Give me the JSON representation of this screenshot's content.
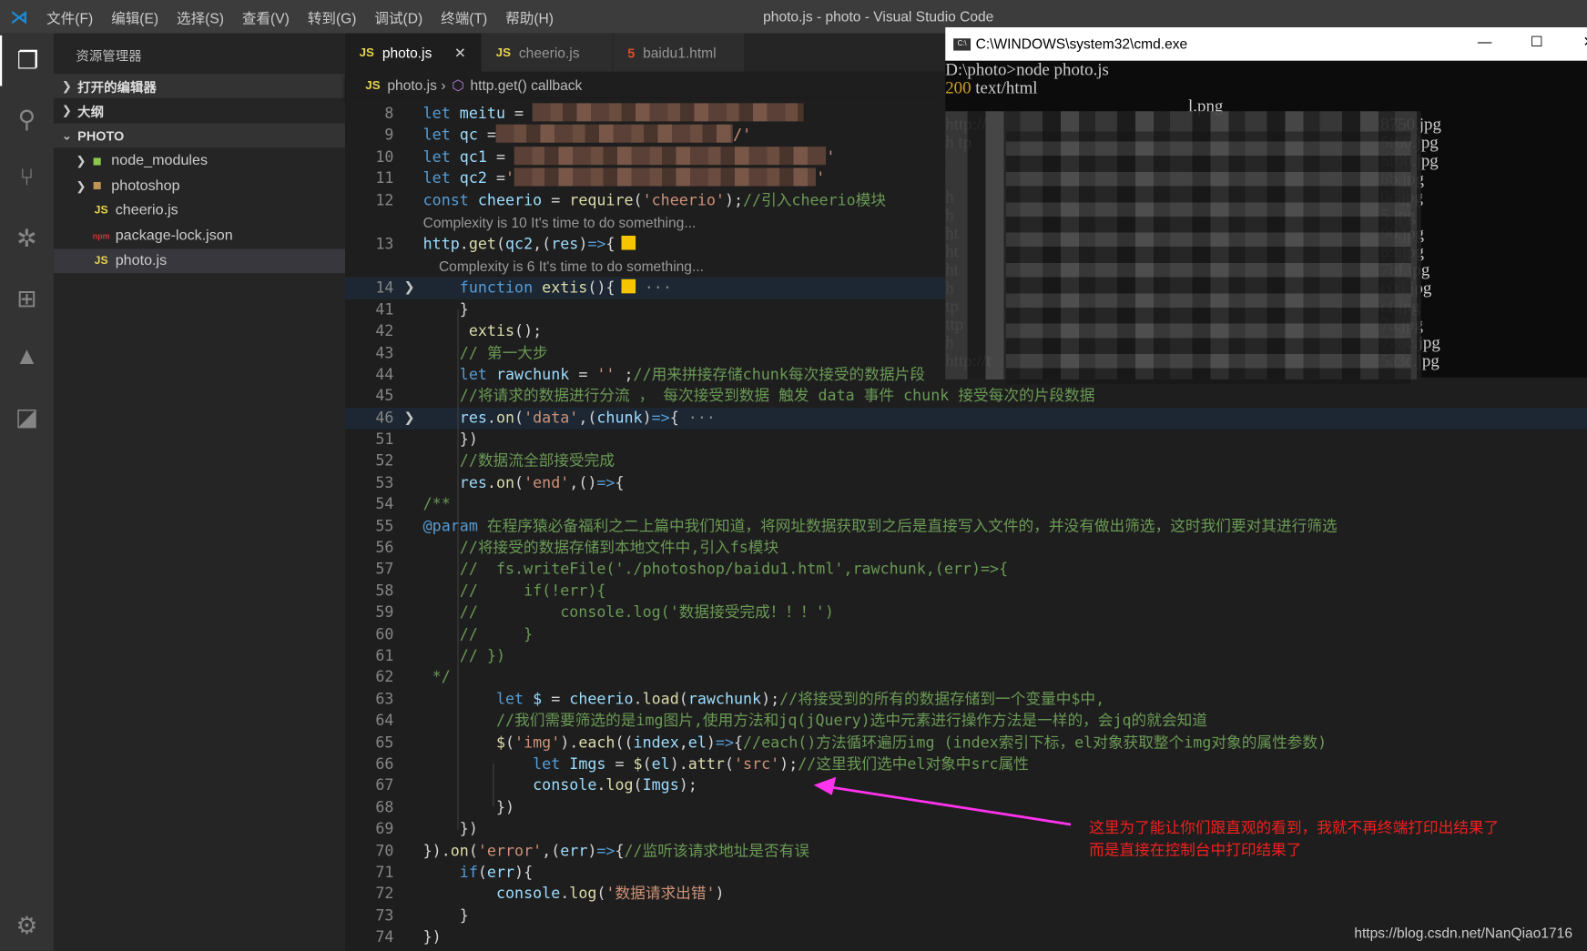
{
  "titlebar": {
    "menu": [
      "文件(F)",
      "编辑(E)",
      "选择(S)",
      "查看(V)",
      "转到(G)",
      "调试(D)",
      "终端(T)",
      "帮助(H)"
    ],
    "title": "photo.js - photo - Visual Studio Code"
  },
  "activity": [
    "files-icon",
    "search-icon",
    "source-control-icon",
    "debug-icon",
    "extensions-icon",
    "azure-icon",
    "remote-icon"
  ],
  "sidebar": {
    "header": "资源管理器",
    "sections": {
      "open_editors": "打开的编辑器",
      "outline": "大纲",
      "folder": "PHOTO"
    },
    "files": [
      {
        "name": "node_modules",
        "type": "folder",
        "icon": "node-folder-icon"
      },
      {
        "name": "photoshop",
        "type": "folder",
        "icon": "folder-icon"
      },
      {
        "name": "cheerio.js",
        "type": "js",
        "icon": "JS"
      },
      {
        "name": "package-lock.json",
        "type": "npm",
        "icon": "npm"
      },
      {
        "name": "photo.js",
        "type": "js",
        "icon": "JS",
        "selected": true
      }
    ]
  },
  "tabs": [
    {
      "label": "photo.js",
      "icon": "JS",
      "active": true,
      "close": "✕"
    },
    {
      "label": "cheerio.js",
      "icon": "JS"
    },
    {
      "label": "baidu1.html",
      "icon": "5"
    }
  ],
  "breadcrumb": {
    "file": "photo.js",
    "symbol": "http.get() callback",
    "icon": "JS"
  },
  "code": [
    {
      "n": "8",
      "t": [
        [
          "kw",
          "let"
        ],
        [
          "var",
          " meitu"
        ],
        [
          "op",
          " = "
        ],
        [
          "blur",
          ""
        ]
      ]
    },
    {
      "n": "9",
      "t": [
        [
          "kw",
          "let"
        ],
        [
          "var",
          " qc"
        ],
        [
          "op",
          " ="
        ],
        [
          "blur",
          ""
        ],
        [
          "str",
          "/'"
        ]
      ]
    },
    {
      "n": "10",
      "t": [
        [
          "kw",
          "let"
        ],
        [
          "var",
          " qc1"
        ],
        [
          "op",
          " = "
        ],
        [
          "blur",
          ""
        ],
        [
          "str",
          "'"
        ]
      ]
    },
    {
      "n": "11",
      "t": [
        [
          "kw",
          "let"
        ],
        [
          "var",
          " qc2"
        ],
        [
          "op",
          " ="
        ],
        [
          "str",
          "'"
        ],
        [
          "blur",
          ""
        ],
        [
          "str",
          "'"
        ]
      ]
    },
    {
      "n": "12",
      "t": [
        [
          "kw",
          "const"
        ],
        [
          "var",
          " cheerio"
        ],
        [
          "op",
          " = "
        ],
        [
          "fn",
          "require"
        ],
        [
          "pl",
          "("
        ],
        [
          "str",
          "'cheerio'"
        ],
        [
          "pl",
          ");"
        ],
        [
          "cm",
          "//引入cheerio模块"
        ]
      ]
    },
    {
      "lens": "Complexity is 10 It's time to do something..."
    },
    {
      "n": "13",
      "t": [
        [
          "var",
          "http"
        ],
        [
          "pl",
          "."
        ],
        [
          "fn",
          "get"
        ],
        [
          "pl",
          "("
        ],
        [
          "var",
          "qc2"
        ],
        [
          "pl",
          ",("
        ],
        [
          "var",
          "res"
        ],
        [
          "pl",
          ")"
        ],
        [
          "kw",
          "=>"
        ],
        [
          "pl",
          "{"
        ],
        [
          "sq",
          ""
        ]
      ]
    },
    {
      "lens": "    Complexity is 6 It's time to do something..."
    },
    {
      "n": "14",
      "fold": true,
      "hl": true,
      "t": [
        [
          "pl",
          "    "
        ],
        [
          "kw",
          "function"
        ],
        [
          "fn",
          " extis"
        ],
        [
          "pl",
          "(){"
        ],
        [
          "sq",
          ""
        ],
        [
          "dots",
          " ···"
        ]
      ]
    },
    {
      "n": "41",
      "t": [
        [
          "pl",
          "    }"
        ]
      ]
    },
    {
      "n": "42",
      "t": [
        [
          "pl",
          "     "
        ],
        [
          "fn",
          "extis"
        ],
        [
          "pl",
          "();"
        ]
      ]
    },
    {
      "n": "43",
      "t": [
        [
          "cm",
          "    // 第一大步"
        ]
      ]
    },
    {
      "n": "44",
      "t": [
        [
          "pl",
          "    "
        ],
        [
          "kw",
          "let"
        ],
        [
          "var",
          " rawchunk"
        ],
        [
          "op",
          " = "
        ],
        [
          "str",
          "''"
        ],
        [
          "pl",
          " ;"
        ],
        [
          "cm",
          "//用来拼接存储chunk每次接受的数据片段"
        ]
      ]
    },
    {
      "n": "45",
      "t": [
        [
          "cm",
          "    //将请求的数据进行分流 ， 每次接受到数据 触发 data 事件 chunk 接受每次的片段数据"
        ]
      ]
    },
    {
      "n": "46",
      "fold": true,
      "hl": true,
      "t": [
        [
          "pl",
          "    "
        ],
        [
          "var",
          "res"
        ],
        [
          "pl",
          "."
        ],
        [
          "fn",
          "on"
        ],
        [
          "pl",
          "("
        ],
        [
          "str",
          "'data'"
        ],
        [
          "pl",
          ",("
        ],
        [
          "var",
          "chunk"
        ],
        [
          "pl",
          ")"
        ],
        [
          "kw",
          "=>"
        ],
        [
          "pl",
          "{"
        ],
        [
          "dots",
          " ···"
        ]
      ]
    },
    {
      "n": "51",
      "t": [
        [
          "pl",
          "    })"
        ]
      ]
    },
    {
      "n": "52",
      "t": [
        [
          "cm",
          "    //数据流全部接受完成"
        ]
      ]
    },
    {
      "n": "53",
      "t": [
        [
          "pl",
          "    "
        ],
        [
          "var",
          "res"
        ],
        [
          "pl",
          "."
        ],
        [
          "fn",
          "on"
        ],
        [
          "pl",
          "("
        ],
        [
          "str",
          "'end'"
        ],
        [
          "pl",
          ",()"
        ],
        [
          "kw",
          "=>"
        ],
        [
          "pl",
          "{"
        ]
      ]
    },
    {
      "n": "54",
      "t": [
        [
          "cm",
          "/**"
        ]
      ]
    },
    {
      "n": "55",
      "t": [
        [
          "kw",
          "@param"
        ],
        [
          "cm",
          " 在程序猿必备福利之二上篇中我们知道，将网址数据获取到之后是直接写入文件的，并没有做出筛选，这时我们要对其进行筛选"
        ]
      ]
    },
    {
      "n": "56",
      "t": [
        [
          "cm",
          "    //将接受的数据存储到本地文件中,引入fs模块"
        ]
      ]
    },
    {
      "n": "57",
      "t": [
        [
          "cm",
          "    //  fs.writeFile('./photoshop/baidu1.html',rawchunk,(err)=>{"
        ]
      ]
    },
    {
      "n": "58",
      "t": [
        [
          "cm",
          "    //     if(!err){"
        ]
      ]
    },
    {
      "n": "59",
      "t": [
        [
          "cm",
          "    //         console.log('数据接受完成！！！')"
        ]
      ]
    },
    {
      "n": "60",
      "t": [
        [
          "cm",
          "    //     }"
        ]
      ]
    },
    {
      "n": "61",
      "t": [
        [
          "cm",
          "    // })"
        ]
      ]
    },
    {
      "n": "62",
      "t": [
        [
          "cm",
          " */"
        ]
      ]
    },
    {
      "n": "63",
      "t": [
        [
          "pl",
          "        "
        ],
        [
          "kw",
          "let"
        ],
        [
          "var",
          " $"
        ],
        [
          "op",
          " = "
        ],
        [
          "var",
          "cheerio"
        ],
        [
          "pl",
          "."
        ],
        [
          "fn",
          "load"
        ],
        [
          "pl",
          "("
        ],
        [
          "var",
          "rawchunk"
        ],
        [
          "pl",
          ");"
        ],
        [
          "cm",
          "//将接受到的所有的数据存储到一个变量中$中,"
        ]
      ]
    },
    {
      "n": "64",
      "t": [
        [
          "cm",
          "        //我们需要筛选的是img图片,使用方法和jq(jQuery)选中元素进行操作方法是一样的，会jq的就会知道"
        ]
      ]
    },
    {
      "n": "65",
      "t": [
        [
          "pl",
          "        "
        ],
        [
          "fn",
          "$"
        ],
        [
          "pl",
          "("
        ],
        [
          "str",
          "'img'"
        ],
        [
          "pl",
          ")."
        ],
        [
          "fn",
          "each"
        ],
        [
          "pl",
          "(("
        ],
        [
          "var",
          "index"
        ],
        [
          "pl",
          ","
        ],
        [
          "var",
          "el"
        ],
        [
          "pl",
          ")"
        ],
        [
          "kw",
          "=>"
        ],
        [
          "pl",
          "{"
        ],
        [
          "cm",
          "//each()方法循环遍历img (index索引下标，el对象获取整个img对象的属性参数)"
        ]
      ]
    },
    {
      "n": "66",
      "t": [
        [
          "pl",
          "            "
        ],
        [
          "kw",
          "let"
        ],
        [
          "var",
          " Imgs"
        ],
        [
          "op",
          " = "
        ],
        [
          "fn",
          "$"
        ],
        [
          "pl",
          "("
        ],
        [
          "var",
          "el"
        ],
        [
          "pl",
          ")."
        ],
        [
          "fn",
          "attr"
        ],
        [
          "pl",
          "("
        ],
        [
          "str",
          "'src'"
        ],
        [
          "pl",
          ");"
        ],
        [
          "cm",
          "//这里我们选中el对象中src属性"
        ]
      ]
    },
    {
      "n": "67",
      "t": [
        [
          "pl",
          "            "
        ],
        [
          "var",
          "console"
        ],
        [
          "pl",
          "."
        ],
        [
          "fn",
          "log"
        ],
        [
          "pl",
          "("
        ],
        [
          "var",
          "Imgs"
        ],
        [
          "pl",
          ");"
        ]
      ]
    },
    {
      "n": "68",
      "t": [
        [
          "pl",
          "        })"
        ]
      ]
    },
    {
      "n": "69",
      "t": [
        [
          "pl",
          "    })"
        ]
      ]
    },
    {
      "n": "70",
      "t": [
        [
          "pl",
          "})."
        ],
        [
          "fn",
          "on"
        ],
        [
          "pl",
          "("
        ],
        [
          "str",
          "'error'"
        ],
        [
          "pl",
          ",("
        ],
        [
          "var",
          "err"
        ],
        [
          "pl",
          ")"
        ],
        [
          "kw",
          "=>"
        ],
        [
          "pl",
          "{"
        ],
        [
          "cm",
          "//监听该请求地址是否有误"
        ]
      ]
    },
    {
      "n": "71",
      "t": [
        [
          "pl",
          "    "
        ],
        [
          "kw",
          "if"
        ],
        [
          "pl",
          "("
        ],
        [
          "var",
          "err"
        ],
        [
          "pl",
          "){"
        ]
      ]
    },
    {
      "n": "72",
      "t": [
        [
          "pl",
          "        "
        ],
        [
          "var",
          "console"
        ],
        [
          "pl",
          "."
        ],
        [
          "fn",
          "log"
        ],
        [
          "pl",
          "("
        ],
        [
          "str",
          "'数据请求出错'"
        ],
        [
          "pl",
          ")"
        ]
      ]
    },
    {
      "n": "73",
      "t": [
        [
          "pl",
          "    }"
        ]
      ]
    },
    {
      "n": "74",
      "t": [
        [
          "pl",
          "})"
        ]
      ]
    }
  ],
  "cmd": {
    "title": "C:\\WINDOWS\\system32\\cmd.exe",
    "controls": [
      "—",
      "☐",
      "✕"
    ],
    "prompt": "D:\\photo>node photo.js",
    "status_code": "200",
    "status_text": " text/html",
    "lines": [
      [
        "",
        "l.png"
      ],
      [
        "http://",
        "8750.jpg"
      ],
      [
        "h tp",
        "5f60.jpg"
      ],
      [
        "",
        "5f0b.jpg"
      ],
      [
        "",
        "8b.jpg"
      ],
      [
        "h",
        "0c.jpg"
      ],
      [
        "h",
        "5.jpg"
      ],
      [
        "ht",
        "90.jpg"
      ],
      [
        "ht",
        "89.jpg"
      ],
      [
        "ht",
        "7bf.jpg"
      ],
      [
        "h",
        "c0d.jpg"
      ],
      [
        "tp",
        "cf.jpg"
      ],
      [
        "ttp",
        "7a.jpg"
      ],
      [
        "h",
        "775c.jpg"
      ],
      [
        "http://t",
        "5a3c.jpg"
      ]
    ]
  },
  "annotation": {
    "color": "#ff33ee",
    "lines": [
      "这里为了能让你们跟直观的看到，我就不再终端打印出结果了",
      "而是直接在控制台中打印结果了"
    ]
  },
  "credit": "https://blog.csdn.net/NanQiao1716"
}
